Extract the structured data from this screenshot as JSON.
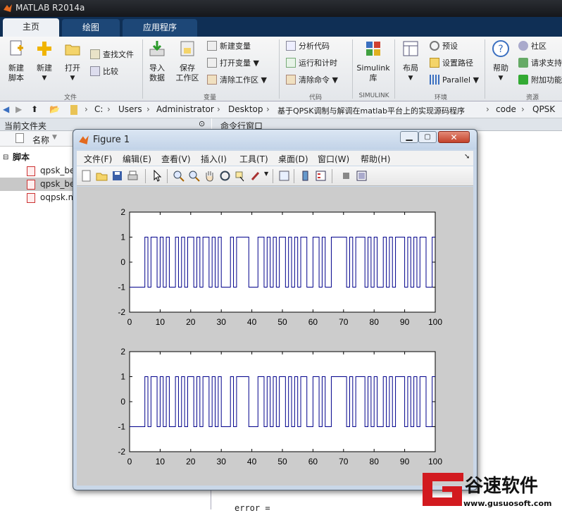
{
  "window": {
    "title": "MATLAB R2014a"
  },
  "tabs": [
    {
      "label": "主页"
    },
    {
      "label": "绘图"
    },
    {
      "label": "应用程序"
    }
  ],
  "ribbon": {
    "file": {
      "group": "文件",
      "new_script": "新建\n脚本",
      "new": "新建",
      "open": "打开",
      "find_files": "查找文件",
      "compare": "比较"
    },
    "variable": {
      "group": "变量",
      "import": "导入\n数据",
      "save_ws": "保存\n工作区",
      "new_var": "新建变量",
      "open_var": "打开变量",
      "clear_ws": "清除工作区"
    },
    "code": {
      "group": "代码",
      "analyze": "分析代码",
      "run_time": "运行和计时",
      "clear_cmd": "清除命令"
    },
    "simulink": {
      "group": "SIMULINK",
      "label": "Simulink\n库"
    },
    "env": {
      "group": "环境",
      "layout": "布局",
      "prefs": "预设",
      "set_path": "设置路径",
      "parallel": "Parallel"
    },
    "resources": {
      "group": "资源",
      "help": "帮助",
      "community": "社区",
      "support": "请求支持",
      "addons": "附加功能"
    }
  },
  "address": {
    "crumbs": [
      "C:",
      "Users",
      "Administrator",
      "Desktop",
      "基于QPSK调制与解调在matlab平台上的实现源码程序",
      "code",
      "QPSK"
    ]
  },
  "current_folder": {
    "title": "当前文件夹",
    "col_name": "名称",
    "section": "脚本",
    "files": [
      "qpsk_be",
      "qpsk_be",
      "oqpsk.m"
    ]
  },
  "command_window": {
    "title": "命令行窗口",
    "text": "error ="
  },
  "figure": {
    "title": "Figure 1",
    "menu": [
      "文件(F)",
      "编辑(E)",
      "查看(V)",
      "插入(I)",
      "工具(T)",
      "桌面(D)",
      "窗口(W)",
      "帮助(H)"
    ]
  },
  "chart_data": [
    {
      "type": "line",
      "xlim": [
        0,
        100
      ],
      "ylim": [
        -2,
        2
      ],
      "xticks": [
        "0",
        "10",
        "20",
        "30",
        "40",
        "50",
        "60",
        "70",
        "80",
        "90",
        "100"
      ],
      "yticks": [
        "2",
        "1",
        "0",
        "-1",
        "-2"
      ],
      "color": "#00008b",
      "series": [
        {
          "values": [
            -1,
            -1,
            -1,
            -1,
            -1,
            1,
            -1,
            1,
            1,
            -1,
            1,
            -1,
            1,
            -1,
            -1,
            1,
            -1,
            1,
            -1,
            1,
            1,
            -1,
            1,
            -1,
            1,
            1,
            -1,
            1,
            -1,
            1,
            -1,
            -1,
            -1,
            1,
            -1,
            1,
            1,
            1,
            1,
            -1,
            -1,
            -1,
            1,
            1,
            -1,
            1,
            -1,
            1,
            -1,
            1,
            1,
            -1,
            1,
            -1,
            1,
            -1,
            1,
            1,
            -1,
            -1,
            1,
            1,
            -1,
            1,
            -1,
            -1,
            1,
            1,
            1,
            1,
            1,
            -1,
            1,
            -1,
            1,
            1,
            1,
            -1,
            1,
            -1,
            1,
            -1,
            -1,
            1,
            -1,
            1,
            -1,
            1,
            1,
            1,
            -1,
            1,
            -1,
            1,
            -1,
            1,
            1,
            -1,
            -1,
            1
          ]
        }
      ]
    },
    {
      "type": "line",
      "xlim": [
        0,
        100
      ],
      "ylim": [
        -2,
        2
      ],
      "xticks": [
        "0",
        "10",
        "20",
        "30",
        "40",
        "50",
        "60",
        "70",
        "80",
        "90",
        "100"
      ],
      "yticks": [
        "2",
        "1",
        "0",
        "-1",
        "-2"
      ],
      "color": "#00008b",
      "series": [
        {
          "values": [
            -1,
            -1,
            -1,
            -1,
            -1,
            1,
            -1,
            1,
            1,
            -1,
            1,
            -1,
            1,
            -1,
            -1,
            1,
            -1,
            1,
            -1,
            1,
            1,
            -1,
            1,
            -1,
            1,
            1,
            -1,
            1,
            -1,
            1,
            -1,
            -1,
            -1,
            1,
            -1,
            1,
            1,
            1,
            1,
            -1,
            -1,
            -1,
            1,
            1,
            -1,
            1,
            -1,
            1,
            -1,
            1,
            1,
            -1,
            1,
            -1,
            1,
            -1,
            1,
            1,
            -1,
            -1,
            1,
            1,
            -1,
            1,
            -1,
            -1,
            1,
            1,
            1,
            1,
            1,
            -1,
            1,
            -1,
            1,
            1,
            1,
            -1,
            1,
            -1,
            1,
            -1,
            -1,
            1,
            -1,
            1,
            -1,
            1,
            1,
            1,
            -1,
            1,
            -1,
            1,
            -1,
            1,
            1,
            -1,
            -1,
            1
          ]
        }
      ]
    }
  ],
  "watermark": {
    "brand": "谷速软件",
    "url": "www.gusuosoft.com"
  }
}
